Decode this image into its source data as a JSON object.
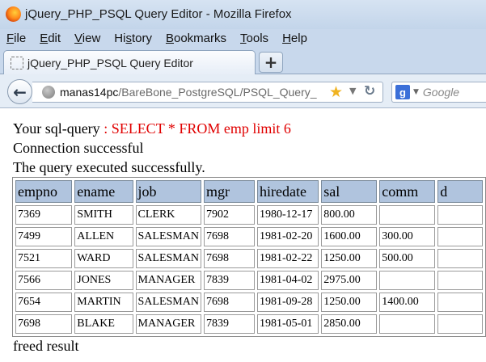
{
  "window": {
    "title": "jQuery_PHP_PSQL Query Editor - Mozilla Firefox"
  },
  "menu": {
    "items": [
      {
        "u": "F",
        "rest": "ile"
      },
      {
        "u": "E",
        "rest": "dit"
      },
      {
        "u": "V",
        "rest": "iew"
      },
      {
        "u": "",
        "pre": "Hi",
        "u2": "s",
        "rest": "tory"
      },
      {
        "u": "B",
        "rest": "ookmarks"
      },
      {
        "u": "T",
        "rest": "ools"
      },
      {
        "u": "H",
        "rest": "elp"
      }
    ]
  },
  "tab": {
    "title": "jQuery_PHP_PSQL Query Editor",
    "new_tab": "+"
  },
  "nav": {
    "back_icon": "back-arrow-icon",
    "url_host": "manas14pc",
    "url_path": "/BareBone_PostgreSQL/PSQL_Query_",
    "search_placeholder": "Google"
  },
  "page": {
    "sql_label": "Your sql-query ",
    "sql_text": ": SELECT * FROM emp limit 6",
    "connection_msg": "Connection successful",
    "query_msg": "The query executed successfully.",
    "freed_msg": "freed result",
    "table": {
      "headers": [
        "empno",
        "ename",
        "job",
        "mgr",
        "hiredate",
        "sal",
        "comm",
        "d"
      ],
      "rows": [
        [
          "7369",
          "SMITH",
          "CLERK",
          "7902",
          "1980-12-17",
          "800.00",
          "",
          ""
        ],
        [
          "7499",
          "ALLEN",
          "SALESMAN",
          "7698",
          "1981-02-20",
          "1600.00",
          "300.00",
          ""
        ],
        [
          "7521",
          "WARD",
          "SALESMAN",
          "7698",
          "1981-02-22",
          "1250.00",
          "500.00",
          ""
        ],
        [
          "7566",
          "JONES",
          "MANAGER",
          "7839",
          "1981-04-02",
          "2975.00",
          "",
          ""
        ],
        [
          "7654",
          "MARTIN",
          "SALESMAN",
          "7698",
          "1981-09-28",
          "1250.00",
          "1400.00",
          ""
        ],
        [
          "7698",
          "BLAKE",
          "MANAGER",
          "7839",
          "1981-05-01",
          "2850.00",
          "",
          ""
        ]
      ]
    }
  },
  "colors": {
    "sql_text": "#e00000",
    "header_bg": "#b0c4de",
    "chrome": "#c8d8ec"
  }
}
